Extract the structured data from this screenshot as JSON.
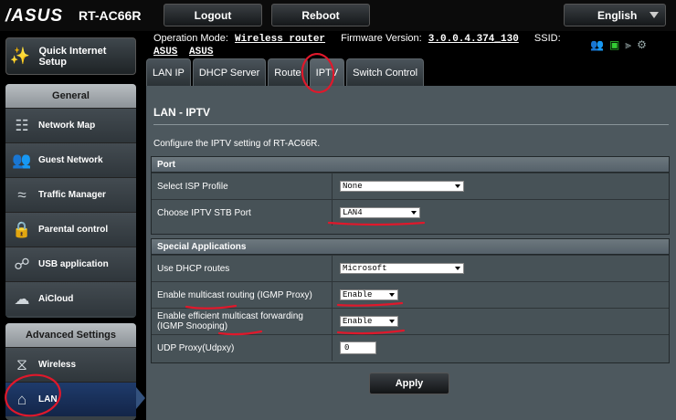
{
  "header": {
    "logo": "/ASUS",
    "model": "RT-AC66R",
    "logout_label": "Logout",
    "reboot_label": "Reboot",
    "language": "English"
  },
  "status": {
    "operation_mode_label": "Operation Mode:",
    "operation_mode_value": "Wireless router",
    "firmware_label": "Firmware Version:",
    "firmware_value": "3.0.0.4.374_130",
    "ssid_label": "SSID:",
    "ssid_values": [
      "ASUS",
      "ASUS"
    ],
    "icons": [
      "users-icon",
      "network-status-icon",
      "usb-icon",
      "settings-icon"
    ]
  },
  "sidebar": {
    "quick_setup_label": "Quick Internet Setup",
    "general_heading": "General",
    "general_items": [
      {
        "label": "Network Map",
        "icon": "network-map-icon"
      },
      {
        "label": "Guest Network",
        "icon": "guest-network-icon"
      },
      {
        "label": "Traffic Manager",
        "icon": "traffic-manager-icon"
      },
      {
        "label": "Parental control",
        "icon": "parental-control-icon"
      },
      {
        "label": "USB application",
        "icon": "usb-application-icon"
      },
      {
        "label": "AiCloud",
        "icon": "aicloud-icon"
      }
    ],
    "advanced_heading": "Advanced Settings",
    "advanced_items": [
      {
        "label": "Wireless",
        "icon": "wireless-icon"
      },
      {
        "label": "LAN",
        "icon": "home-icon"
      }
    ]
  },
  "tabs": [
    {
      "label": "LAN IP"
    },
    {
      "label": "DHCP Server"
    },
    {
      "label": "Route"
    },
    {
      "label": "IPTV"
    },
    {
      "label": "Switch Control"
    }
  ],
  "main": {
    "title": "LAN - IPTV",
    "description": "Configure the IPTV setting of RT-AC66R.",
    "port_heading": "Port",
    "isp_profile_label": "Select ISP Profile",
    "isp_profile_value": "None",
    "stb_port_label": "Choose IPTV STB Port",
    "stb_port_value": "LAN4",
    "special_heading": "Special Applications",
    "dhcp_routes_label": "Use DHCP routes",
    "dhcp_routes_value": "Microsoft",
    "multicast_routing_label": "Enable multicast routing (IGMP Proxy)",
    "multicast_routing_value": "Enable",
    "multicast_forwarding_label": "Enable efficient multicast forwarding (IGMP Snooping)",
    "multicast_forwarding_value": "Enable",
    "udp_proxy_label": "UDP Proxy(Udpxy)",
    "udp_proxy_value": "0",
    "apply_label": "Apply"
  },
  "colors": {
    "annotation_red": "#e0182b",
    "active_menu": "#1f3b6b",
    "panel_bg": "#4d585e"
  }
}
